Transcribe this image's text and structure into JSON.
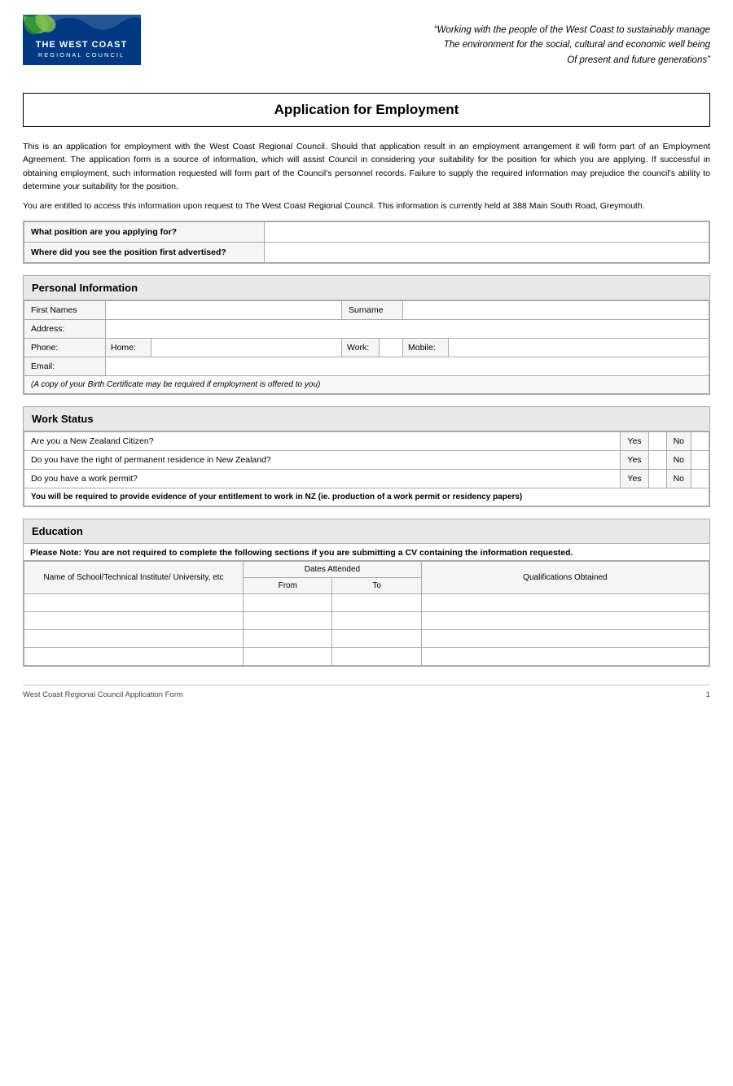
{
  "header": {
    "tagline_line1": "“Working with the people of the West Coast to sustainably manage",
    "tagline_line2": "The environment for the social, cultural and economic well being",
    "tagline_line3": "Of present and future generations”",
    "logo_name": "THE WEST COAST",
    "logo_sub": "REGIONAL COUNCIL"
  },
  "title": "Application for Employment",
  "intro": {
    "para1": "This is an application for employment with the West Coast Regional Council.  Should that application result in an employment arrangement it will form part of an Employment Agreement.  The application form is a source of information, which will assist Council in considering your suitability for the position for which you are applying.  If successful in obtaining employment, such information requested will form part of the Council’s personnel records.  Failure to supply the required information may prejudice the council’s ability to determine your suitability for the position.",
    "para2": "You are entitled to access this information upon request to The West Coast Regional Council.  This information is currently held at 388 Main South Road, Greymouth."
  },
  "position_section": {
    "row1_label": "What position are you applying for?",
    "row2_label": "Where did you see the position first advertised?"
  },
  "personal_section": {
    "header": "Personal Information",
    "first_names_label": "First Names",
    "surname_label": "Surname",
    "address_label": "Address:",
    "phone_label": "Phone:",
    "home_label": "Home:",
    "work_label": "Work:",
    "mobile_label": "Mobile:",
    "email_label": "Email:",
    "birth_cert_note": "(A copy of your Birth Certificate may be required if employment is offered to you)"
  },
  "work_status_section": {
    "header": "Work Status",
    "q1": "Are you a New Zealand Citizen?",
    "q2": "Do you have the right of permanent residence in New Zealand?",
    "q3": "Do you have a work permit?",
    "yes_label": "Yes",
    "no_label": "No",
    "notice": "You will be required to provide evidence of your entitlement to work in NZ (ie. production of a work permit or residency papers)"
  },
  "education_section": {
    "header": "Education",
    "notice": "Please Note: You are not required to complete the following sections if you are submitting a CV containing the information requested.",
    "col_school": "Name of School/Technical Institute/ University, etc",
    "col_dates": "Dates Attended",
    "col_from": "From",
    "col_to": "To",
    "col_qual": "Qualifications Obtained",
    "rows": [
      {
        "school": "",
        "from": "",
        "to": "",
        "qual": ""
      },
      {
        "school": "",
        "from": "",
        "to": "",
        "qual": ""
      },
      {
        "school": "",
        "from": "",
        "to": "",
        "qual": ""
      },
      {
        "school": "",
        "from": "",
        "to": "",
        "qual": ""
      }
    ]
  },
  "footer": {
    "left": "West Coast Regional Council Application Form",
    "right": "1"
  }
}
